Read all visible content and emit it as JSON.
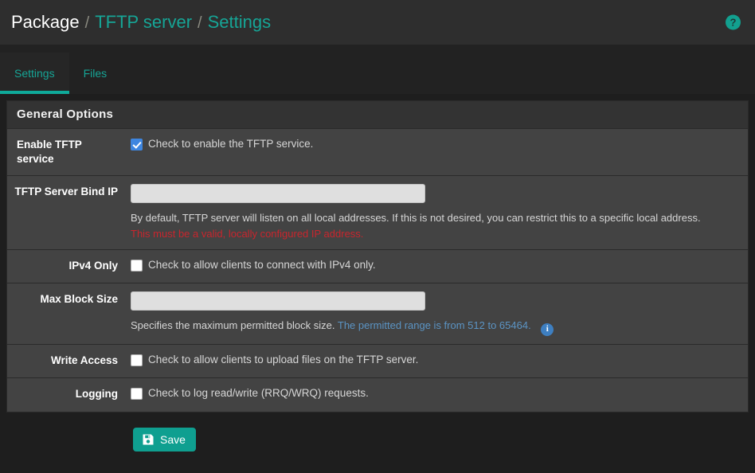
{
  "header": {
    "breadcrumb": {
      "root": "Package",
      "sep1": "/",
      "section": "TFTP server",
      "sep2": "/",
      "current": "Settings"
    },
    "help_icon": "?",
    "help_icon_name": "help-circle-icon"
  },
  "tabs": [
    {
      "label": "Settings",
      "active": true
    },
    {
      "label": "Files",
      "active": false
    }
  ],
  "panel": {
    "title": "General Options",
    "rows": {
      "enable_service": {
        "label": "Enable TFTP service",
        "checkbox_text": "Check to enable the TFTP service.",
        "checked": true
      },
      "bind_ip": {
        "label": "TFTP Server Bind IP",
        "value": "",
        "placeholder": "",
        "help": "By default, TFTP server will listen on all local addresses. If this is not desired, you can restrict this to a specific local address.",
        "error": "This must be a valid, locally configured IP address."
      },
      "ipv4_only": {
        "label": "IPv4 Only",
        "checkbox_text": "Check to allow clients to connect with IPv4 only.",
        "checked": false
      },
      "max_block_size": {
        "label": "Max Block Size",
        "value": "",
        "placeholder": "",
        "help": "Specifies the maximum permitted block size.",
        "help_range": "The permitted range is from 512 to 65464.",
        "info_icon": "i"
      },
      "write_access": {
        "label": "Write Access",
        "checkbox_text": "Check to allow clients to upload files on the TFTP server.",
        "checked": false
      },
      "logging": {
        "label": "Logging",
        "checkbox_text": "Check to log read/write (RRQ/WRQ) requests.",
        "checked": false
      }
    }
  },
  "footer": {
    "save_label": "Save",
    "save_icon": "floppy-disk-icon"
  },
  "colors": {
    "accent_teal": "#16a596",
    "checkbox_blue": "#3e86e0",
    "info_blue": "#3e7fc1",
    "error_red": "#c9252d",
    "panel_bg": "#434343",
    "page_bg": "#1e1e1e"
  }
}
